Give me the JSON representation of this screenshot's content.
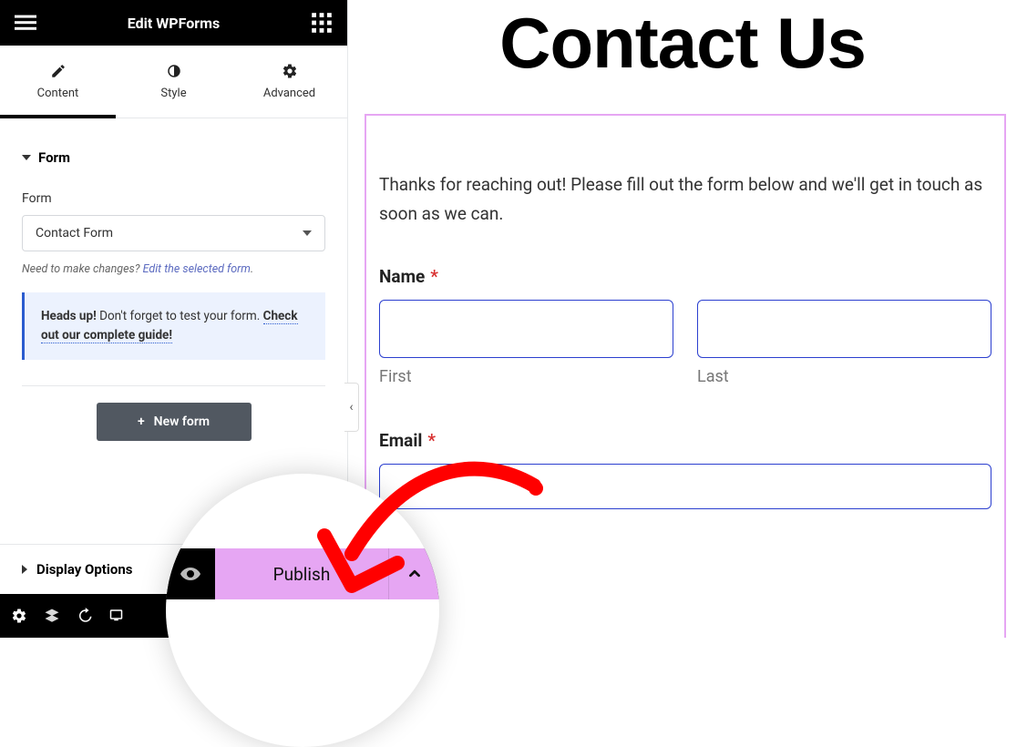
{
  "header": {
    "title": "Edit WPForms"
  },
  "tabs": {
    "content": "Content",
    "style": "Style",
    "advanced": "Advanced"
  },
  "form_section": {
    "title": "Form",
    "field_label": "Form",
    "selected": "Contact Form",
    "helper_prefix": "Need to make changes? ",
    "helper_link": "Edit the selected form",
    "notice_strong": "Heads up!",
    "notice_rest": " Don't forget to test your form. ",
    "notice_link": "Check out our complete guide!",
    "new_form_btn": "New form"
  },
  "display_options": {
    "title": "Display Options"
  },
  "publish": {
    "label": "Publish"
  },
  "preview": {
    "heading": "Contact Us",
    "intro": "Thanks for reaching out! Please fill out the form below and we'll get in touch as soon as we can.",
    "name_label": "Name",
    "first_sub": "First",
    "last_sub": "Last",
    "email_label": "Email"
  }
}
